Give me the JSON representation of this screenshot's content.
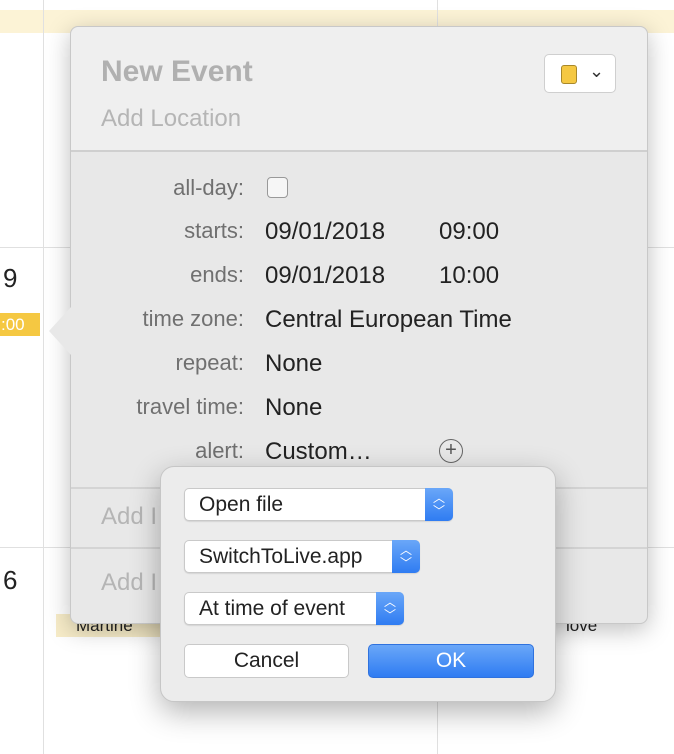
{
  "calendar": {
    "day_numbers": [
      "9",
      "6"
    ],
    "event_time_fragment": ":00",
    "event_fragment_left": "Martine",
    "event_fragment_right": "love",
    "event_color": "#f5c842"
  },
  "popover": {
    "title": "New Event",
    "location_placeholder": "Add Location",
    "calendar_color": "#f5c842",
    "fields": {
      "all_day_label": "all-day:",
      "all_day_checked": false,
      "starts_label": "starts:",
      "starts_date": "09/01/2018",
      "starts_time": "09:00",
      "ends_label": "ends:",
      "ends_date": "09/01/2018",
      "ends_time": "10:00",
      "time_zone_label": "time zone:",
      "time_zone_value": "Central European Time",
      "repeat_label": "repeat:",
      "repeat_value": "None",
      "travel_time_label": "travel time:",
      "travel_time_value": "None",
      "alert_label": "alert:",
      "alert_value": "Custom…"
    },
    "add_row_1": "Add I",
    "add_row_2": "Add I"
  },
  "alert_dialog": {
    "action_select": "Open file",
    "file_select": "SwitchToLive.app",
    "timing_select": "At time of event",
    "cancel_label": "Cancel",
    "ok_label": "OK",
    "accent_color": "#3b82f6"
  }
}
